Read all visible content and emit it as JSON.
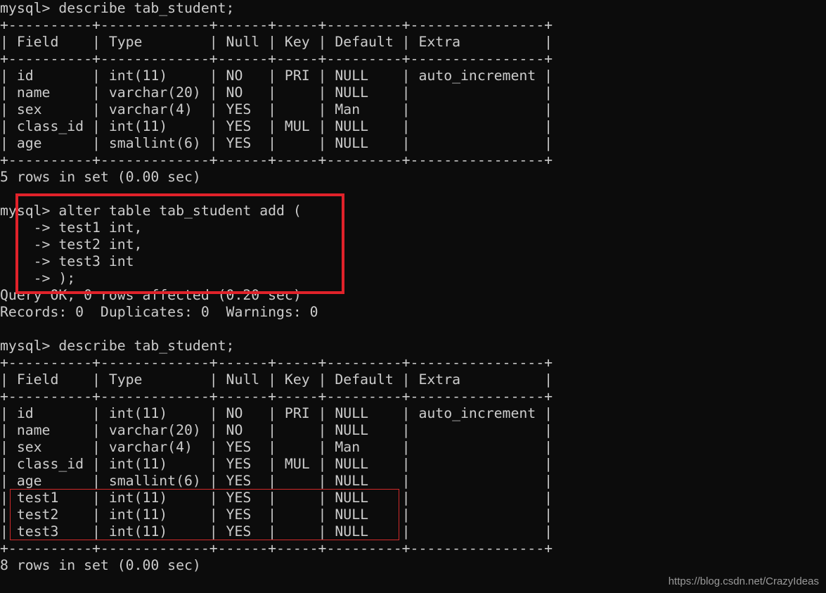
{
  "terminal": {
    "lines": [
      "mysql> describe tab_student;",
      "+----------+-------------+------+-----+---------+----------------+",
      "| Field    | Type        | Null | Key | Default | Extra          |",
      "+----------+-------------+------+-----+---------+----------------+",
      "| id       | int(11)     | NO   | PRI | NULL    | auto_increment |",
      "| name     | varchar(20) | NO   |     | NULL    |                |",
      "| sex      | varchar(4)  | YES  |     | Man     |                |",
      "| class_id | int(11)     | YES  | MUL | NULL    |                |",
      "| age      | smallint(6) | YES  |     | NULL    |                |",
      "+----------+-------------+------+-----+---------+----------------+",
      "5 rows in set (0.00 sec)",
      "",
      "mysql> alter table tab_student add (",
      "    -> test1 int,",
      "    -> test2 int,",
      "    -> test3 int",
      "    -> );",
      "Query OK, 0 rows affected (0.20 sec)",
      "Records: 0  Duplicates: 0  Warnings: 0",
      "",
      "mysql> describe tab_student;",
      "+----------+-------------+------+-----+---------+----------------+",
      "| Field    | Type        | Null | Key | Default | Extra          |",
      "+----------+-------------+------+-----+---------+----------------+",
      "| id       | int(11)     | NO   | PRI | NULL    | auto_increment |",
      "| name     | varchar(20) | NO   |     | NULL    |                |",
      "| sex      | varchar(4)  | YES  |     | Man     |                |",
      "| class_id | int(11)     | YES  | MUL | NULL    |                |",
      "| age      | smallint(6) | YES  |     | NULL    |                |",
      "| test1    | int(11)     | YES  |     | NULL    |                |",
      "| test2    | int(11)     | YES  |     | NULL    |                |",
      "| test3    | int(11)     | YES  |     | NULL    |                |",
      "+----------+-------------+------+-----+---------+----------------+",
      "8 rows in set (0.00 sec)",
      ""
    ]
  },
  "watermark": "https://blog.csdn.net/CrazyIdeas",
  "colors": {
    "background": "#0c0c0c",
    "text": "#cccccc",
    "highlight": "#e0222a"
  }
}
